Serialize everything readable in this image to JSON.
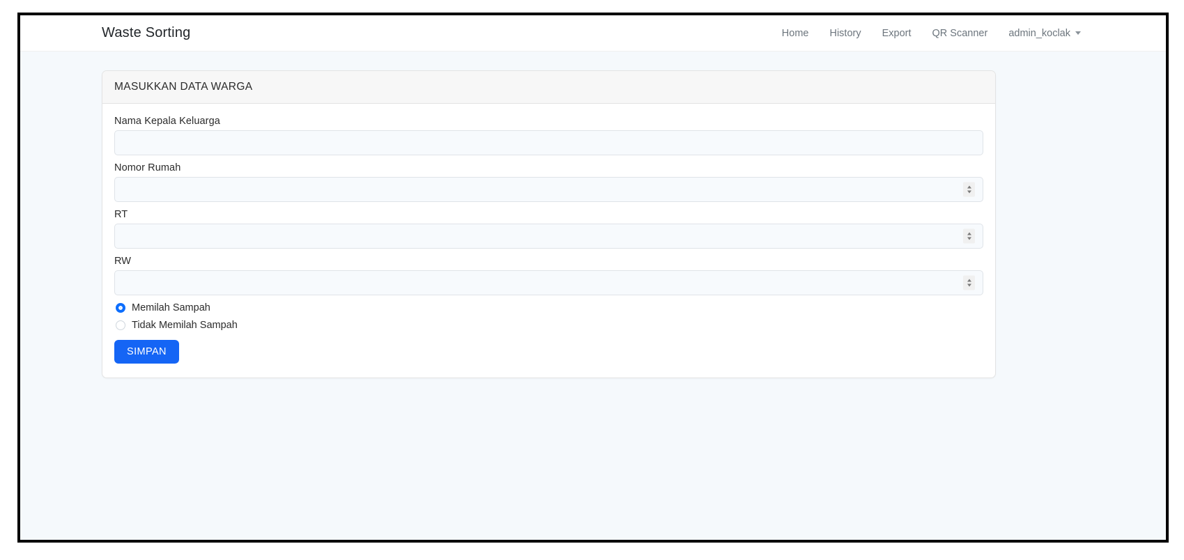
{
  "navbar": {
    "brand": "Waste Sorting",
    "links": [
      {
        "label": "Home"
      },
      {
        "label": "History"
      },
      {
        "label": "Export"
      },
      {
        "label": "QR Scanner"
      }
    ],
    "user": {
      "name": "admin_koclak",
      "caret_icon": "chevron-down-icon"
    }
  },
  "card": {
    "header": "MASUKKAN DATA WARGA",
    "fields": [
      {
        "label": "Nama Kepala Keluarga",
        "value": "",
        "placeholder": "",
        "type": "text"
      },
      {
        "label": "Nomor Rumah",
        "value": "",
        "placeholder": "",
        "type": "number"
      },
      {
        "label": "RT",
        "value": "",
        "placeholder": "",
        "type": "number"
      },
      {
        "label": "RW",
        "value": "",
        "placeholder": "",
        "type": "number"
      }
    ],
    "radio_options": [
      {
        "label": "Memilah Sampah",
        "selected": true
      },
      {
        "label": "Tidak Memilah Sampah",
        "selected": false
      }
    ],
    "submit_label": "SIMPAN"
  },
  "colors": {
    "accent": "#1565f5",
    "radio_accent": "#0d6efd",
    "page_background": "#f5f9fc",
    "card_header_background": "#f7f7f7",
    "input_background": "#f7fafd",
    "nav_link": "#6c757d"
  }
}
